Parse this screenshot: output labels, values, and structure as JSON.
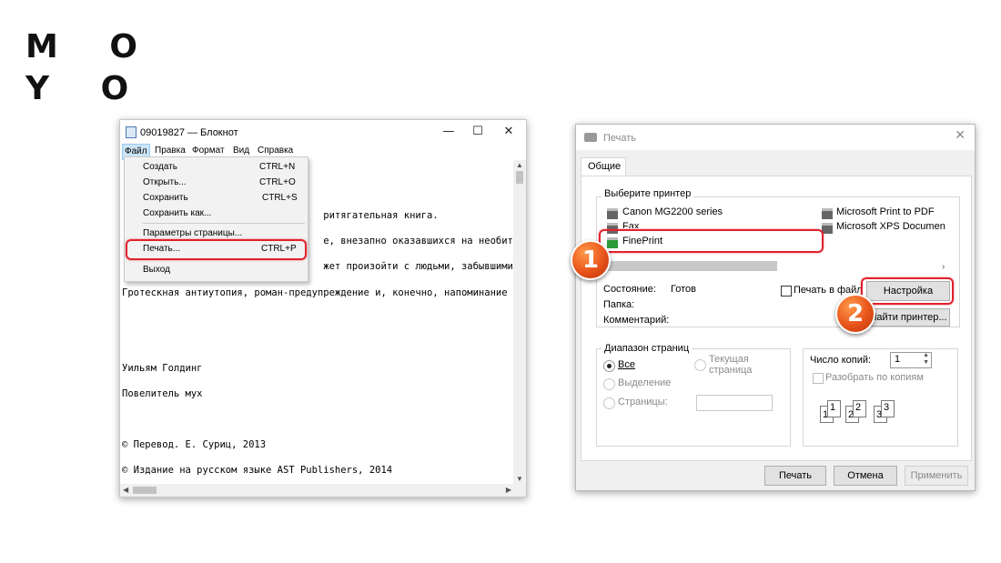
{
  "brand": {
    "logo_line1": "M O",
    "logo_line2": "Y O"
  },
  "notepad": {
    "title": "09019827 — Блокнот",
    "window_controls": [
      "—",
      "☐",
      "✕"
    ],
    "menu": [
      "Файл",
      "Правка",
      "Формат",
      "Вид",
      "Справка"
    ],
    "text_lines": [
      "                                   ритягательная книга.",
      "                                   е, внезапно оказавшихся на необитае",
      "                                   жет произойти с людьми, забывшими о л",
      "Гротескная антиутопия, роман-предупреждение и, конечно, напоминание с",
      "Уильям Голдинг",
      "Повелитель мух",
      "© Перевод. Е. Суриц, 2013",
      "© Издание на русском языке AST Publishers, 2014"
    ],
    "file_menu": [
      {
        "label": "Создать",
        "shortcut": "CTRL+N"
      },
      {
        "label": "Открыть...",
        "shortcut": "CTRL+O"
      },
      {
        "label": "Сохранить",
        "shortcut": "CTRL+S"
      },
      {
        "label": "Сохранить как...",
        "shortcut": ""
      },
      {
        "label": "Параметры страницы...",
        "shortcut": ""
      },
      {
        "label": "Печать...",
        "shortcut": "CTRL+P"
      },
      {
        "label": "Выход",
        "shortcut": ""
      }
    ]
  },
  "print_dialog": {
    "title": "Печать",
    "close": "✕",
    "tab_general": "Общие",
    "select_printer_label": "Выберите принтер",
    "printers": [
      "Canon MG2200 series",
      "Fax",
      "FinePrint",
      "Microsoft Print to PDF",
      "Microsoft XPS Documen"
    ],
    "status_label": "Состояние:",
    "status_value": "Готов",
    "folder_label": "Папка:",
    "comment_label": "Комментарий:",
    "print_to_file": "Печать в файл",
    "settings_button": "Настройка",
    "find_printer_button": "Найти принтер...",
    "page_range_label": "Диапазон страниц",
    "range_all": "Все",
    "range_selection": "Выделение",
    "range_pages": "Страницы:",
    "range_current": "Текущая страница",
    "copies_label": "Число копий:",
    "copies_value": "1",
    "collate_label": "Разобрать по копиям",
    "collate_icons": [
      "1",
      "1",
      "2",
      "2",
      "3",
      "3"
    ],
    "buttons": {
      "print": "Печать",
      "cancel": "Отмена",
      "apply": "Применить"
    }
  },
  "callouts": {
    "step1": "1",
    "step2": "2"
  },
  "colors": {
    "highlight_red": "#e0222d",
    "badge_orange": "#e8531a"
  }
}
